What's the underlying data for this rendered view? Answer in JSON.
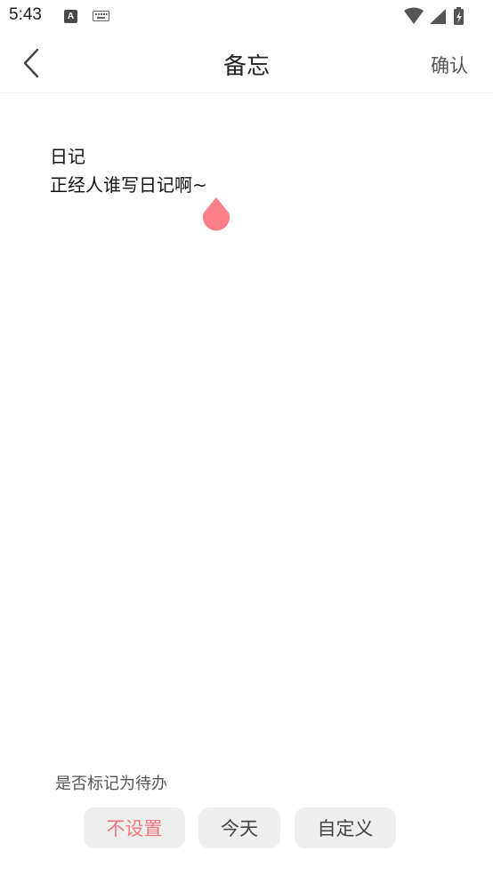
{
  "status_bar": {
    "time": "5:43",
    "icons": [
      "a-icon",
      "keyboard-icon",
      "wifi-icon",
      "signal-icon",
      "battery-charging-icon"
    ]
  },
  "header": {
    "title": "备忘",
    "confirm_label": "确认"
  },
  "memo": {
    "lines": [
      "日记",
      "正经人谁写日记啊~"
    ]
  },
  "todo": {
    "label": "是否标记为待办",
    "options": [
      {
        "label": "不设置",
        "selected": true
      },
      {
        "label": "今天",
        "selected": false
      },
      {
        "label": "自定义",
        "selected": false
      }
    ]
  },
  "colors": {
    "accent": "#f5767c",
    "handle": "#fc7f8a",
    "chip_bg": "#efefef"
  }
}
